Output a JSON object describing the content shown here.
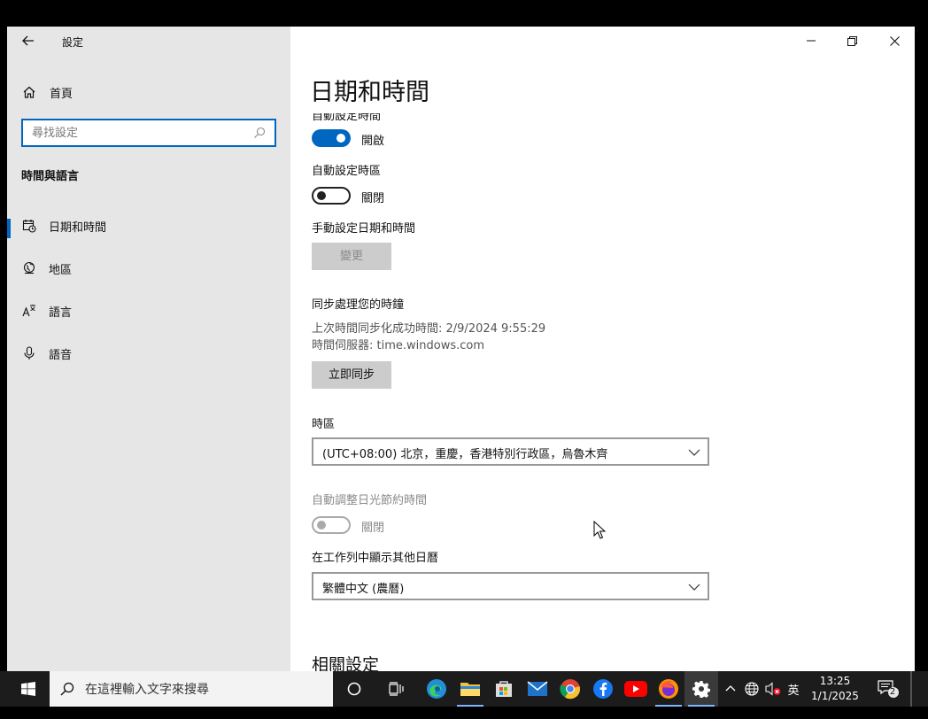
{
  "window": {
    "app_title": "設定",
    "controls": {
      "minimize": "minimize",
      "restore": "restore",
      "close": "close"
    }
  },
  "sidebar": {
    "home_label": "首頁",
    "search_placeholder": "尋找設定",
    "section_title": "時間與語言",
    "items": [
      {
        "label": "日期和時間",
        "icon": "calendar-clock-icon",
        "selected": true
      },
      {
        "label": "地區",
        "icon": "globe-region-icon",
        "selected": false
      },
      {
        "label": "語言",
        "icon": "language-icon",
        "selected": false
      },
      {
        "label": "語音",
        "icon": "microphone-icon",
        "selected": false
      }
    ]
  },
  "main": {
    "page_title": "日期和時間",
    "auto_time": {
      "label": "自動設定時間",
      "state": "開啟",
      "on": true
    },
    "auto_timezone": {
      "label": "自動設定時區",
      "state": "關閉",
      "on": false
    },
    "manual": {
      "label": "手動設定日期和時間",
      "button": "變更"
    },
    "sync": {
      "label": "同步處理您的時鐘",
      "last_sync": "上次時間同步化成功時間: 2/9/2024 9:55:29",
      "server": "時間伺服器: time.windows.com",
      "button": "立即同步"
    },
    "timezone": {
      "label": "時區",
      "value": "(UTC+08:00) 北京，重慶，香港特別行政區，烏魯木齊"
    },
    "dst": {
      "label": "自動調整日光節約時間",
      "state": "關閉",
      "on": false,
      "disabled": true
    },
    "calendar": {
      "label": "在工作列中顯示其他日曆",
      "value": "繁體中文 (農曆)"
    },
    "related_title": "相關設定"
  },
  "taskbar": {
    "search_text": "在這裡輸入文字來搜尋",
    "ime": "英",
    "time": "13:25",
    "date": "1/1/2025",
    "notification_count": "2",
    "accent": "#0067c0"
  }
}
